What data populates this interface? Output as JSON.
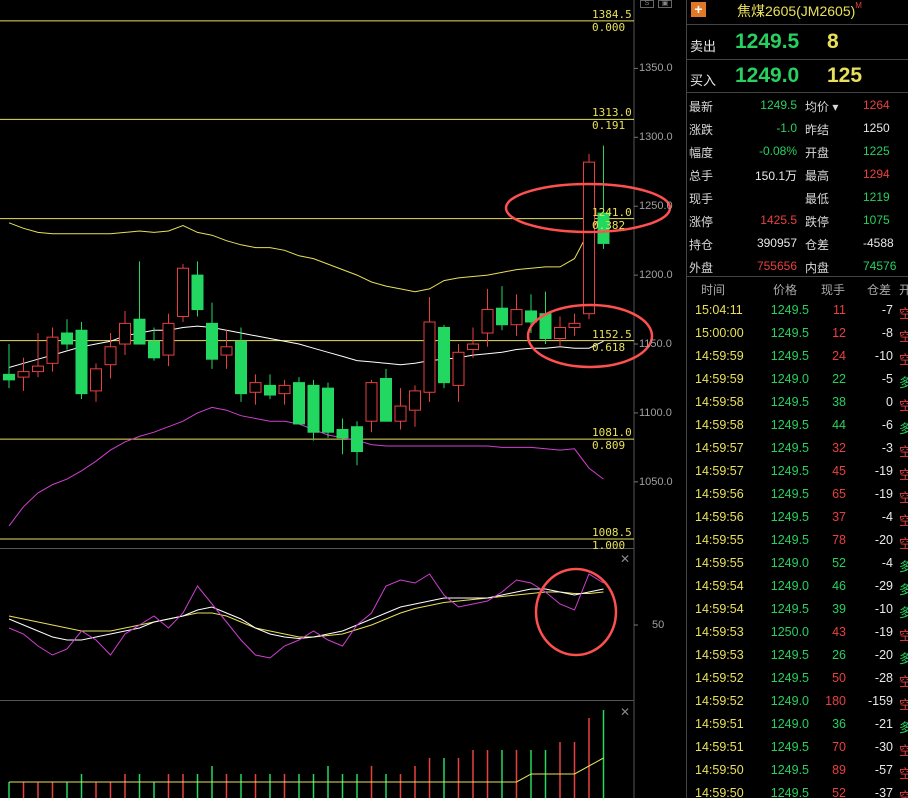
{
  "panel": {
    "title": "焦煤2605(JM2605)",
    "title_mark": "M",
    "ask_label": "卖出",
    "ask_price": "1249.5",
    "ask_volume": "8",
    "bid_label": "买入",
    "bid_price": "1249.0",
    "bid_volume": "125",
    "stats": [
      {
        "l1": "最新",
        "v1": "1249.5",
        "c1": "#28d060",
        "l2": "均价 ▾",
        "v2": "1264",
        "c2": "#e84040"
      },
      {
        "l1": "涨跌",
        "v1": "-1.0",
        "c1": "#28d060",
        "l2": "昨结",
        "v2": "1250",
        "c2": "#e8e8e8"
      },
      {
        "l1": "幅度",
        "v1": "-0.08%",
        "c1": "#28d060",
        "l2": "开盘",
        "v2": "1225",
        "c2": "#28d060"
      },
      {
        "l1": "总手",
        "v1": "150.1万",
        "c1": "#e8e8e8",
        "l2": "最高",
        "v2": "1294",
        "c2": "#e84040"
      },
      {
        "l1": "现手",
        "v1": "",
        "c1": "#e8e8e8",
        "l2": "最低",
        "v2": "1219",
        "c2": "#28d060"
      },
      {
        "l1": "涨停",
        "v1": "1425.5",
        "c1": "#e84040",
        "l2": "跌停",
        "v2": "1075",
        "c2": "#28d060"
      },
      {
        "l1": "持仓",
        "v1": "390957",
        "c1": "#e8e8e8",
        "l2": "仓差",
        "v2": "-4588",
        "c2": "#e8e8e8"
      },
      {
        "l1": "外盘",
        "v1": "755656",
        "c1": "#e84040",
        "l2": "内盘",
        "v2": "74576",
        "c2": "#28d060"
      }
    ],
    "trade_headers": {
      "time": "时间",
      "price": "价格",
      "volume": "现手",
      "oi": "仓差",
      "nature": "开"
    },
    "trades": [
      {
        "time": "15:04:11",
        "price": "1249.5",
        "vol": "11",
        "vc": "#e84040",
        "oi": "-7",
        "nat": "空",
        "nc": "#e84040"
      },
      {
        "time": "15:00:00",
        "price": "1249.5",
        "vol": "12",
        "vc": "#e84040",
        "oi": "-8",
        "nat": "空",
        "nc": "#e84040"
      },
      {
        "time": "14:59:59",
        "price": "1249.5",
        "vol": "24",
        "vc": "#e84040",
        "oi": "-10",
        "nat": "空",
        "nc": "#e84040"
      },
      {
        "time": "14:59:59",
        "price": "1249.0",
        "vol": "22",
        "vc": "#28d060",
        "oi": "-5",
        "nat": "多",
        "nc": "#28d060"
      },
      {
        "time": "14:59:58",
        "price": "1249.5",
        "vol": "38",
        "vc": "#28d060",
        "oi": "0",
        "nat": "空",
        "nc": "#e84040"
      },
      {
        "time": "14:59:58",
        "price": "1249.5",
        "vol": "44",
        "vc": "#28d060",
        "oi": "-6",
        "nat": "多",
        "nc": "#28d060"
      },
      {
        "time": "14:59:57",
        "price": "1249.5",
        "vol": "32",
        "vc": "#e84040",
        "oi": "-3",
        "nat": "空",
        "nc": "#e84040"
      },
      {
        "time": "14:59:57",
        "price": "1249.5",
        "vol": "45",
        "vc": "#e84040",
        "oi": "-19",
        "nat": "空",
        "nc": "#e84040"
      },
      {
        "time": "14:59:56",
        "price": "1249.5",
        "vol": "65",
        "vc": "#e84040",
        "oi": "-19",
        "nat": "空",
        "nc": "#e84040"
      },
      {
        "time": "14:59:56",
        "price": "1249.5",
        "vol": "37",
        "vc": "#e84040",
        "oi": "-4",
        "nat": "空",
        "nc": "#e84040"
      },
      {
        "time": "14:59:55",
        "price": "1249.5",
        "vol": "78",
        "vc": "#e84040",
        "oi": "-20",
        "nat": "空",
        "nc": "#e84040"
      },
      {
        "time": "14:59:55",
        "price": "1249.0",
        "vol": "52",
        "vc": "#28d060",
        "oi": "-4",
        "nat": "多",
        "nc": "#28d060"
      },
      {
        "time": "14:59:54",
        "price": "1249.0",
        "vol": "46",
        "vc": "#28d060",
        "oi": "-29",
        "nat": "多",
        "nc": "#28d060"
      },
      {
        "time": "14:59:54",
        "price": "1249.5",
        "vol": "39",
        "vc": "#28d060",
        "oi": "-10",
        "nat": "多",
        "nc": "#28d060"
      },
      {
        "time": "14:59:53",
        "price": "1250.0",
        "vol": "43",
        "vc": "#e84040",
        "oi": "-19",
        "nat": "空",
        "nc": "#e84040"
      },
      {
        "time": "14:59:53",
        "price": "1249.5",
        "vol": "26",
        "vc": "#28d060",
        "oi": "-20",
        "nat": "多",
        "nc": "#28d060"
      },
      {
        "time": "14:59:52",
        "price": "1249.5",
        "vol": "50",
        "vc": "#e84040",
        "oi": "-28",
        "nat": "空",
        "nc": "#e84040"
      },
      {
        "time": "14:59:52",
        "price": "1249.0",
        "vol": "180",
        "vc": "#e84040",
        "oi": "-159",
        "nat": "空",
        "nc": "#e84040"
      },
      {
        "time": "14:59:51",
        "price": "1249.0",
        "vol": "36",
        "vc": "#28d060",
        "oi": "-21",
        "nat": "多",
        "nc": "#28d060"
      },
      {
        "time": "14:59:51",
        "price": "1249.5",
        "vol": "70",
        "vc": "#e84040",
        "oi": "-30",
        "nat": "空",
        "nc": "#e84040"
      },
      {
        "time": "14:59:50",
        "price": "1249.5",
        "vol": "89",
        "vc": "#e84040",
        "oi": "-57",
        "nat": "空",
        "nc": "#e84040"
      },
      {
        "time": "14:59:50",
        "price": "1249.5",
        "vol": "52",
        "vc": "#e84040",
        "oi": "-37",
        "nat": "空",
        "nc": "#e84040"
      }
    ]
  },
  "chart_data": {
    "type": "candlestick",
    "y_ticks": [
      "1350.0",
      "1300.0",
      "1250.0",
      "1200.0",
      "1150.0",
      "1100.0",
      "1050.0"
    ],
    "y_tick_values": [
      1350,
      1300,
      1250,
      1200,
      1150,
      1100,
      1050
    ],
    "ylim": [
      1002,
      1396
    ],
    "osc_tick": "50",
    "colors": {
      "up": "#e84040",
      "down": "#22d860",
      "fib": "#e8e05a",
      "boll_upper": "#e8e05a",
      "boll_mid": "#ffffff",
      "boll_lower": "#d040d0",
      "highlight": "#ff5050"
    },
    "fib_levels": [
      {
        "price": 1384.5,
        "price_label": "1384.5",
        "ratio": "0.000"
      },
      {
        "price": 1313.0,
        "price_label": "1313.0",
        "ratio": "0.191"
      },
      {
        "price": 1241.0,
        "price_label": "1241.0",
        "ratio": "0.382"
      },
      {
        "price": 1152.5,
        "price_label": "1152.5",
        "ratio": "0.618"
      },
      {
        "price": 1081.0,
        "price_label": "1081.0",
        "ratio": "0.809"
      },
      {
        "price": 1008.5,
        "price_label": "1008.5",
        "ratio": "1.000"
      }
    ],
    "candles": [
      {
        "o": 1128,
        "h": 1150,
        "l": 1118,
        "c": 1124
      },
      {
        "o": 1126,
        "h": 1140,
        "l": 1116,
        "c": 1130
      },
      {
        "o": 1130,
        "h": 1158,
        "l": 1126,
        "c": 1134
      },
      {
        "o": 1136,
        "h": 1162,
        "l": 1130,
        "c": 1155
      },
      {
        "o": 1158,
        "h": 1168,
        "l": 1146,
        "c": 1150
      },
      {
        "o": 1160,
        "h": 1166,
        "l": 1110,
        "c": 1114
      },
      {
        "o": 1116,
        "h": 1136,
        "l": 1108,
        "c": 1132
      },
      {
        "o": 1135,
        "h": 1158,
        "l": 1125,
        "c": 1148
      },
      {
        "o": 1150,
        "h": 1174,
        "l": 1142,
        "c": 1165
      },
      {
        "o": 1168,
        "h": 1210,
        "l": 1150,
        "c": 1150
      },
      {
        "o": 1152,
        "h": 1162,
        "l": 1138,
        "c": 1140
      },
      {
        "o": 1142,
        "h": 1172,
        "l": 1134,
        "c": 1165
      },
      {
        "o": 1170,
        "h": 1208,
        "l": 1166,
        "c": 1205
      },
      {
        "o": 1200,
        "h": 1210,
        "l": 1170,
        "c": 1175
      },
      {
        "o": 1165,
        "h": 1180,
        "l": 1132,
        "c": 1139
      },
      {
        "o": 1142,
        "h": 1160,
        "l": 1132,
        "c": 1148
      },
      {
        "o": 1152,
        "h": 1162,
        "l": 1108,
        "c": 1114
      },
      {
        "o": 1115,
        "h": 1128,
        "l": 1106,
        "c": 1122
      },
      {
        "o": 1120,
        "h": 1128,
        "l": 1110,
        "c": 1113
      },
      {
        "o": 1114,
        "h": 1124,
        "l": 1106,
        "c": 1120
      },
      {
        "o": 1122,
        "h": 1126,
        "l": 1092,
        "c": 1092
      },
      {
        "o": 1120,
        "h": 1124,
        "l": 1080,
        "c": 1086
      },
      {
        "o": 1118,
        "h": 1122,
        "l": 1082,
        "c": 1086
      },
      {
        "o": 1088,
        "h": 1096,
        "l": 1070,
        "c": 1082
      },
      {
        "o": 1090,
        "h": 1094,
        "l": 1062,
        "c": 1072
      },
      {
        "o": 1094,
        "h": 1124,
        "l": 1086,
        "c": 1122
      },
      {
        "o": 1125,
        "h": 1132,
        "l": 1094,
        "c": 1094
      },
      {
        "o": 1094,
        "h": 1118,
        "l": 1088,
        "c": 1105
      },
      {
        "o": 1102,
        "h": 1120,
        "l": 1090,
        "c": 1116
      },
      {
        "o": 1115,
        "h": 1184,
        "l": 1108,
        "c": 1166
      },
      {
        "o": 1162,
        "h": 1164,
        "l": 1118,
        "c": 1122
      },
      {
        "o": 1120,
        "h": 1150,
        "l": 1108,
        "c": 1144
      },
      {
        "o": 1146,
        "h": 1162,
        "l": 1140,
        "c": 1150
      },
      {
        "o": 1158,
        "h": 1190,
        "l": 1148,
        "c": 1175
      },
      {
        "o": 1176,
        "h": 1192,
        "l": 1160,
        "c": 1164
      },
      {
        "o": 1164,
        "h": 1186,
        "l": 1156,
        "c": 1175
      },
      {
        "o": 1174,
        "h": 1186,
        "l": 1158,
        "c": 1166
      },
      {
        "o": 1172,
        "h": 1188,
        "l": 1150,
        "c": 1154
      },
      {
        "o": 1154,
        "h": 1170,
        "l": 1148,
        "c": 1162
      },
      {
        "o": 1162,
        "h": 1172,
        "l": 1156,
        "c": 1165
      },
      {
        "o": 1172,
        "h": 1288,
        "l": 1168,
        "c": 1282
      },
      {
        "o": 1245,
        "h": 1294,
        "l": 1219,
        "c": 1223
      }
    ],
    "boll_upper": [
      1238,
      1234,
      1231,
      1230,
      1230,
      1230,
      1230,
      1230,
      1231,
      1232,
      1231,
      1232,
      1236,
      1231,
      1229,
      1225,
      1222,
      1220,
      1220,
      1218,
      1214,
      1212,
      1208,
      1204,
      1200,
      1195,
      1192,
      1190,
      1188,
      1190,
      1196,
      1198,
      1199,
      1200,
      1202,
      1204,
      1205,
      1206,
      1206,
      1212,
      1232,
      1244
    ],
    "boll_mid": [
      1133,
      1136,
      1139,
      1142,
      1145,
      1148,
      1150,
      1152,
      1156,
      1158,
      1160,
      1160,
      1162,
      1163,
      1162,
      1160,
      1158,
      1156,
      1154,
      1152,
      1150,
      1147,
      1144,
      1141,
      1138,
      1137,
      1136,
      1135,
      1136,
      1138,
      1139,
      1140,
      1142,
      1143,
      1144,
      1146,
      1147,
      1147,
      1148,
      1147,
      1147,
      1152
    ],
    "boll_lower": [
      1018,
      1032,
      1042,
      1048,
      1052,
      1058,
      1065,
      1073,
      1079,
      1083,
      1086,
      1090,
      1094,
      1100,
      1104,
      1102,
      1098,
      1096,
      1094,
      1094,
      1092,
      1088,
      1084,
      1082,
      1080,
      1077,
      1076,
      1076,
      1076,
      1076,
      1076,
      1076,
      1076,
      1076,
      1075,
      1075,
      1075,
      1074,
      1073,
      1074,
      1060,
      1052
    ],
    "osc_k": [
      48,
      44,
      36,
      30,
      34,
      46,
      40,
      30,
      44,
      50,
      56,
      48,
      58,
      76,
      64,
      52,
      40,
      30,
      28,
      36,
      40,
      46,
      40,
      36,
      50,
      58,
      76,
      80,
      78,
      84,
      70,
      62,
      64,
      66,
      72,
      80,
      78,
      72,
      64,
      60,
      84,
      78
    ],
    "osc_d": [
      54,
      50,
      46,
      42,
      40,
      40,
      42,
      44,
      46,
      48,
      52,
      54,
      56,
      60,
      62,
      58,
      54,
      48,
      44,
      42,
      41,
      42,
      44,
      46,
      50,
      54,
      58,
      62,
      64,
      66,
      68,
      68,
      68,
      68,
      70,
      72,
      74,
      74,
      72,
      70,
      72,
      74
    ],
    "osc_j": [
      56,
      54,
      52,
      50,
      48,
      46,
      46,
      46,
      48,
      50,
      52,
      54,
      56,
      58,
      58,
      56,
      52,
      48,
      46,
      44,
      42,
      42,
      43,
      44,
      47,
      50,
      54,
      58,
      61,
      63,
      65,
      66,
      67,
      68,
      69,
      70,
      71,
      72,
      72,
      71,
      71,
      72
    ],
    "volumes": [
      2,
      2,
      2,
      2,
      2,
      3,
      2,
      2,
      3,
      3,
      2,
      3,
      3,
      3,
      4,
      3,
      3,
      3,
      3,
      3,
      3,
      3,
      4,
      3,
      3,
      4,
      3,
      3,
      4,
      5,
      5,
      5,
      6,
      6,
      6,
      6,
      6,
      6,
      7,
      7,
      10,
      11
    ],
    "vol_ma": [
      2,
      2,
      2,
      2,
      2,
      2,
      2,
      2,
      2,
      2,
      2,
      2,
      2,
      2,
      2,
      2,
      2,
      2,
      2,
      2,
      2,
      2,
      2,
      2,
      2,
      2,
      2,
      2,
      2,
      2,
      2,
      2,
      2,
      2,
      2,
      2,
      3,
      3,
      3,
      3,
      4,
      5
    ]
  }
}
